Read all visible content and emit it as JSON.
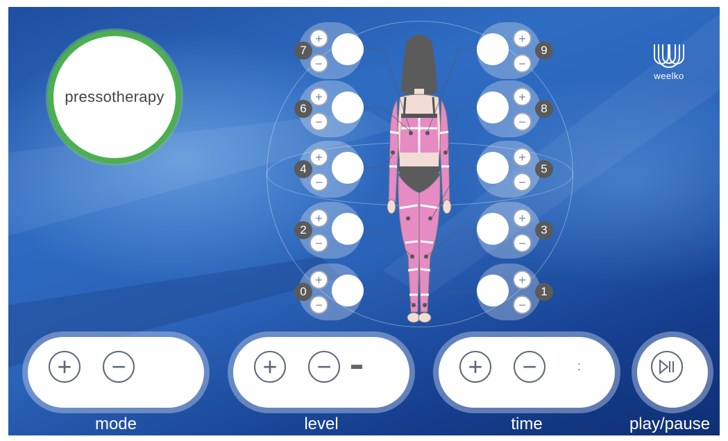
{
  "mode_badge": {
    "label": "pressotherapy"
  },
  "logo": {
    "brand": "weelko"
  },
  "zones": {
    "left": [
      {
        "number": "7",
        "plus": "+",
        "minus": "−"
      },
      {
        "number": "6",
        "plus": "+",
        "minus": "−"
      },
      {
        "number": "4",
        "plus": "+",
        "minus": "−"
      },
      {
        "number": "2",
        "plus": "+",
        "minus": "−"
      },
      {
        "number": "0",
        "plus": "+",
        "minus": "−"
      }
    ],
    "right": [
      {
        "number": "9",
        "plus": "+",
        "minus": "−"
      },
      {
        "number": "8",
        "plus": "+",
        "minus": "−"
      },
      {
        "number": "5",
        "plus": "+",
        "minus": "−"
      },
      {
        "number": "3",
        "plus": "+",
        "minus": "−"
      },
      {
        "number": "1",
        "plus": "+",
        "minus": "−"
      }
    ]
  },
  "controls": {
    "mode": {
      "label": "mode",
      "plus": "+",
      "minus": "−"
    },
    "level": {
      "label": "level",
      "plus": "+",
      "minus": "−"
    },
    "time": {
      "label": "time",
      "plus": "+",
      "minus": "−",
      "value": ":"
    },
    "play": {
      "label": "play/pause"
    }
  },
  "colors": {
    "accent_green": "#4caf50",
    "zone_pink": "#e68bc3",
    "background_blue": "#2a63b8"
  }
}
